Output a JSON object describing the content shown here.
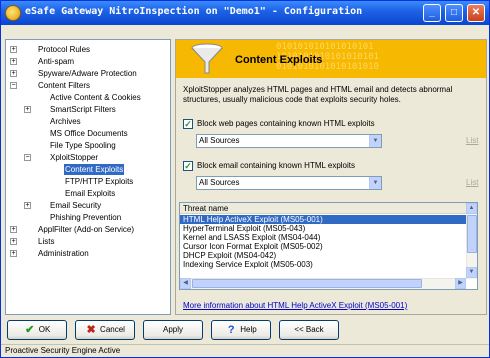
{
  "window": {
    "title": "eSafe Gateway NitroInspection on \"Demo1\" - Configuration",
    "controls": {
      "minimize": "_",
      "maximize": "□",
      "close": "✕"
    }
  },
  "tree": {
    "items": [
      {
        "label": "Protocol Rules",
        "level": 0,
        "expander": "+"
      },
      {
        "label": "Anti-spam",
        "level": 0,
        "expander": "+"
      },
      {
        "label": "Spyware/Adware Protection",
        "level": 0,
        "expander": "+"
      },
      {
        "label": "Content Filters",
        "level": 0,
        "expander": "−"
      },
      {
        "label": "Active Content & Cookies",
        "level": 1,
        "expander": ""
      },
      {
        "label": "SmartScript Filters",
        "level": 1,
        "expander": "+"
      },
      {
        "label": "Archives",
        "level": 1,
        "expander": ""
      },
      {
        "label": "MS Office Documents",
        "level": 1,
        "expander": ""
      },
      {
        "label": "File Type Spooling",
        "level": 1,
        "expander": ""
      },
      {
        "label": "XploitStopper",
        "level": 1,
        "expander": "−"
      },
      {
        "label": "Content Exploits",
        "level": 2,
        "expander": "",
        "selected": true
      },
      {
        "label": "FTP/HTTP Exploits",
        "level": 2,
        "expander": ""
      },
      {
        "label": "Email Exploits",
        "level": 2,
        "expander": ""
      },
      {
        "label": "Email Security",
        "level": 1,
        "expander": "+"
      },
      {
        "label": "Phishing Prevention",
        "level": 1,
        "expander": ""
      },
      {
        "label": "ApplFilter (Add-on Service)",
        "level": 0,
        "expander": "+"
      },
      {
        "label": "Lists",
        "level": 0,
        "expander": "+"
      },
      {
        "label": "Administration",
        "level": 0,
        "expander": "+"
      }
    ]
  },
  "panel": {
    "banner_title": "Content Exploits",
    "banner_bits": [
      "010101010101010101",
      "1010101010101010101",
      "0101010101010101010"
    ],
    "description": "XploitStopper analyzes HTML pages and HTML email and detects abnormal structures, usually malicious code that exploits security holes.",
    "block_web": {
      "label": "Block web pages containing known HTML exploits",
      "checked": "✓",
      "select_value": "All Sources",
      "list_link": "List"
    },
    "block_email": {
      "label": "Block email containing known HTML exploits",
      "checked": "✓",
      "select_value": "All Sources",
      "list_link": "List"
    },
    "threat_table": {
      "header": "Threat name",
      "rows": [
        "HTML Help ActiveX Exploit (MS05-001)",
        "HyperTerminal Exploit (MS05-043)",
        "Kernel and LSASS Exploit (MS04-044)",
        "Cursor Icon Format Exploit (MS05-002)",
        "DHCP Exploit (MS04-042)",
        "Indexing Service Exploit (MS05-003)"
      ],
      "selected_index": 0
    },
    "more_info_link": "More information about HTML Help ActiveX Exploit (MS05-001)"
  },
  "buttons": {
    "ok": {
      "label": "OK",
      "icon": "✔"
    },
    "cancel": {
      "label": "Cancel",
      "icon": "✖"
    },
    "apply": {
      "label": "Apply"
    },
    "help": {
      "label": "Help",
      "icon": "?"
    },
    "back": {
      "label": "<< Back"
    }
  },
  "status_bar": "Proactive Security Engine Active",
  "colors": {
    "titlebar": "#0a46d1",
    "banner": "#f6b800",
    "selection": "#316ac5",
    "link": "#0000cc"
  }
}
